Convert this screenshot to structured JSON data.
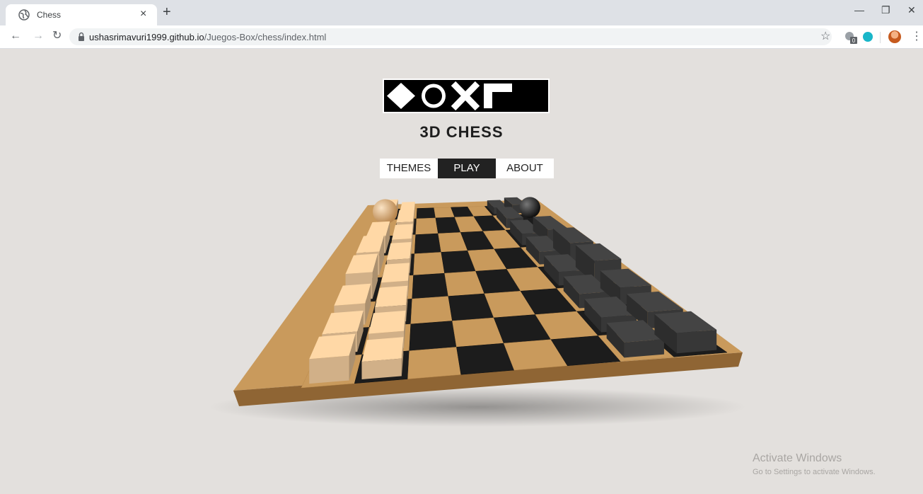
{
  "browser": {
    "tab_title": "Chess",
    "tab_close": "×",
    "new_tab": "+",
    "url_host": "ushasrimavuri1999.github.io",
    "url_path": "/Juegos-Box/chess/index.html",
    "badge_count": "0"
  },
  "page": {
    "title": "3D CHESS",
    "menu": [
      {
        "label": "THEMES",
        "active": false
      },
      {
        "label": "PLAY",
        "active": true
      },
      {
        "label": "ABOUT",
        "active": false
      }
    ]
  },
  "board": {
    "size": 8,
    "light_square": "#c99a5c",
    "dark_square": "#1c1c1c",
    "light_piece": "#eec89a",
    "dark_piece": "#3f3f3f"
  },
  "watermark": {
    "title": "Activate Windows",
    "subtitle": "Go to Settings to activate Windows."
  },
  "icons": [
    "globe-icon",
    "close-icon",
    "plus-icon",
    "back-icon",
    "forward-icon",
    "reload-icon",
    "lock-icon",
    "star-icon",
    "extension-icon",
    "avatar",
    "menu-dots-icon",
    "minimize-icon",
    "restore-icon",
    "window-close-icon"
  ]
}
